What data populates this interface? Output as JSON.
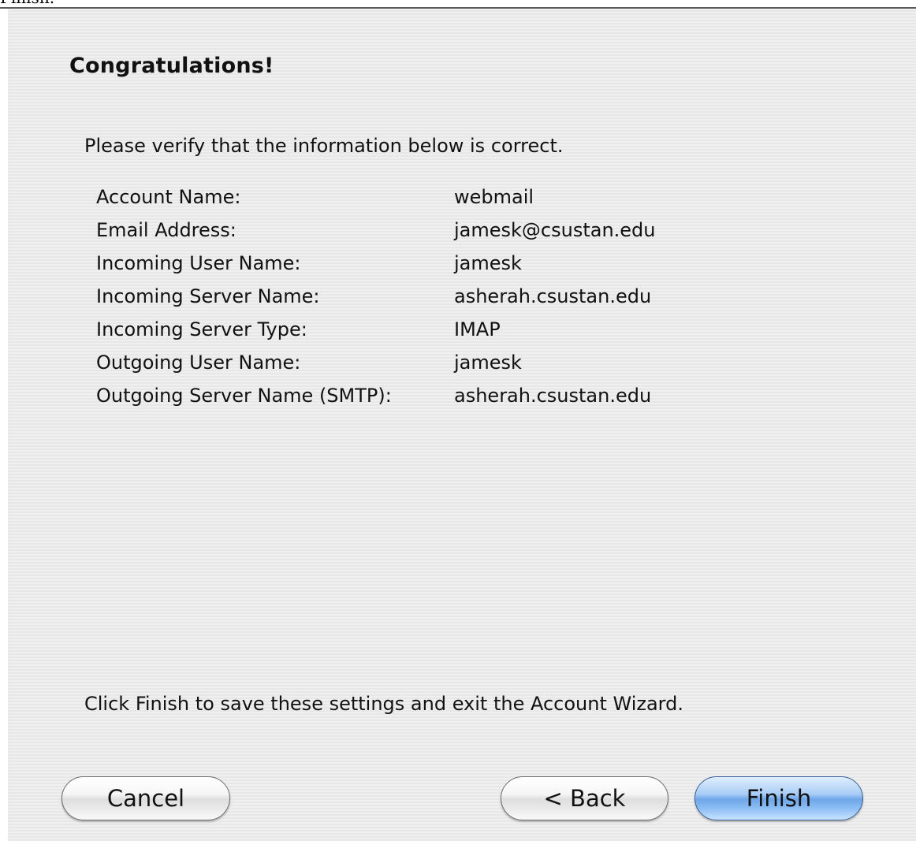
{
  "top_caption": "Finish.",
  "wizard": {
    "title": "Congratulations!",
    "intro": "Please verify that the information below is correct.",
    "fields": [
      {
        "label": "Account Name:",
        "value": "webmail"
      },
      {
        "label": "Email Address:",
        "value": "jamesk@csustan.edu"
      },
      {
        "label": "Incoming User Name:",
        "value": "jamesk"
      },
      {
        "label": "Incoming Server Name:",
        "value": "asherah.csustan.edu"
      },
      {
        "label": "Incoming Server Type:",
        "value": "IMAP"
      },
      {
        "label": "Outgoing User Name:",
        "value": "jamesk"
      },
      {
        "label": "Outgoing Server Name (SMTP):",
        "value": "asherah.csustan.edu"
      }
    ],
    "outro": "Click Finish to save these settings and exit the Account Wizard."
  },
  "buttons": {
    "cancel": "Cancel",
    "back": "< Back",
    "finish": "Finish"
  },
  "colors": {
    "default_button": "#6fa6e8",
    "panel_background": "#ececec"
  }
}
